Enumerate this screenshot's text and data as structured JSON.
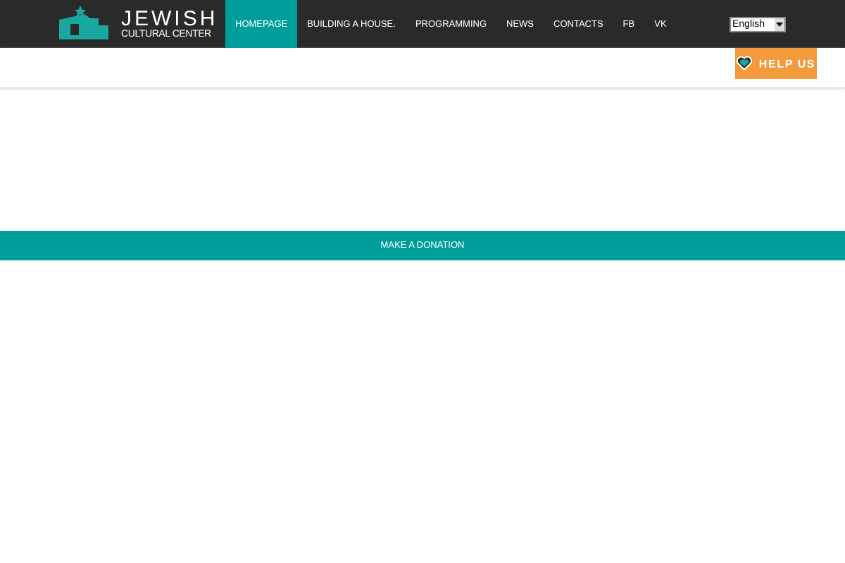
{
  "logo": {
    "title": "JEWISH",
    "subtitle": "CULTURAL CENTER"
  },
  "nav": [
    {
      "label": "HOMEPAGE",
      "selected": true
    },
    {
      "label": "BUILDING A HOUSE.",
      "selected": false
    },
    {
      "label": "PROGRAMMING",
      "selected": false
    },
    {
      "label": "NEWS",
      "selected": false
    },
    {
      "label": "CONTACTS",
      "selected": false
    },
    {
      "label": "FB",
      "selected": false
    },
    {
      "label": "VK",
      "selected": false
    }
  ],
  "language": {
    "value": "English"
  },
  "help_button": {
    "label": "HELP US"
  },
  "donation": {
    "label": "MAKE A DONATION"
  }
}
